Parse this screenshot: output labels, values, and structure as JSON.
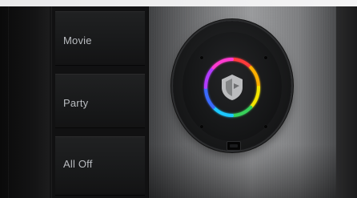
{
  "keypad": {
    "buttons": [
      {
        "label": "Movie"
      },
      {
        "label": "Party"
      },
      {
        "label": "All Off"
      }
    ]
  },
  "controller": {
    "logo_icon": "shield-logo-icon",
    "ring_colors": [
      "#ff3b3b",
      "#ffb000",
      "#f5e600",
      "#37d05a",
      "#1ec8ff",
      "#3a6bff",
      "#b23bff",
      "#ff3bd0"
    ]
  }
}
